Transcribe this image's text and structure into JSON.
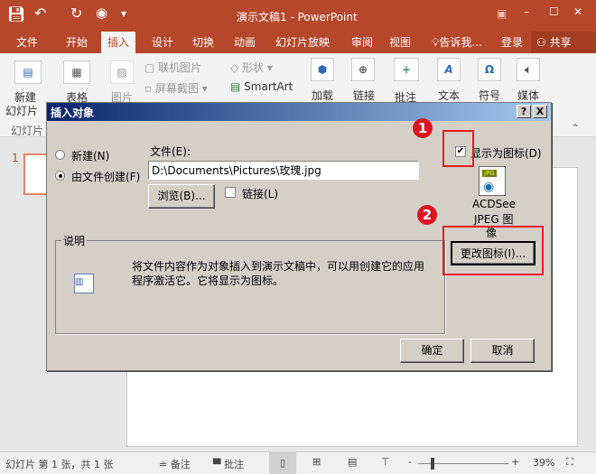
{
  "window": {
    "title": "演示文稿1 - PowerPoint",
    "qat_more": "▾"
  },
  "tabs": [
    {
      "label": "文件"
    },
    {
      "label": "开始"
    },
    {
      "label": "插入",
      "active": true
    },
    {
      "label": "设计"
    },
    {
      "label": "切换"
    },
    {
      "label": "动画"
    },
    {
      "label": "幻灯片放映"
    },
    {
      "label": "审阅"
    },
    {
      "label": "视图"
    }
  ],
  "tell_me": "告诉我...",
  "login": "登录",
  "share": "共享",
  "ribbon": {
    "new_slide_1": "新建",
    "new_slide_2": "幻灯片",
    "table": "表格",
    "picture": "图片",
    "online_picture": "联机图片",
    "screenshot": "屏幕截图",
    "shapes": "形状",
    "smartart": "SmartArt",
    "addins": "加载",
    "links": "链接",
    "comment": "批注",
    "text": "文本",
    "symbols": "符号",
    "media": "媒体",
    "group_slides": "幻灯片"
  },
  "slide_pane": {
    "number": "1"
  },
  "dialog": {
    "title": "插入对象",
    "help": "?",
    "close": "X",
    "radio_new": "新建(N)",
    "radio_from_file": "由文件创建(F)",
    "selected": "from_file",
    "file_label": "文件(E):",
    "file_value": "D:\\Documents\\Pictures\\玫瑰.jpg",
    "browse": "浏览(B)...",
    "link_label": "链接(L)",
    "link_checked": false,
    "display_as_icon": "显示为图标(D)",
    "display_as_icon_checked": true,
    "icon_caption_1": "ACDSee",
    "icon_caption_2": "JPEG 图",
    "icon_caption_3": "像",
    "icon_badge": "JPG",
    "change_icon": "更改图标(I)...",
    "desc_label": "说明",
    "desc_line1": "将文件内容作为对象插入到演示文稿中，可以用创建它的应用",
    "desc_line2": "程序激活它。它将显示为图标。",
    "ok": "确定",
    "cancel": "取消"
  },
  "annotations": {
    "step1": "1",
    "step2": "2",
    "color": "#e0141e"
  },
  "status": {
    "slide_info": "幻灯片 第 1 张，共 1 张",
    "notes": "备注",
    "comments": "批注",
    "zoom": "39%",
    "zoom_minus": "-",
    "zoom_plus": "+",
    "zoom_level_percent": 39
  },
  "colors": {
    "accent": "#b7472a",
    "dialog_bg": "#d4d0c8"
  }
}
